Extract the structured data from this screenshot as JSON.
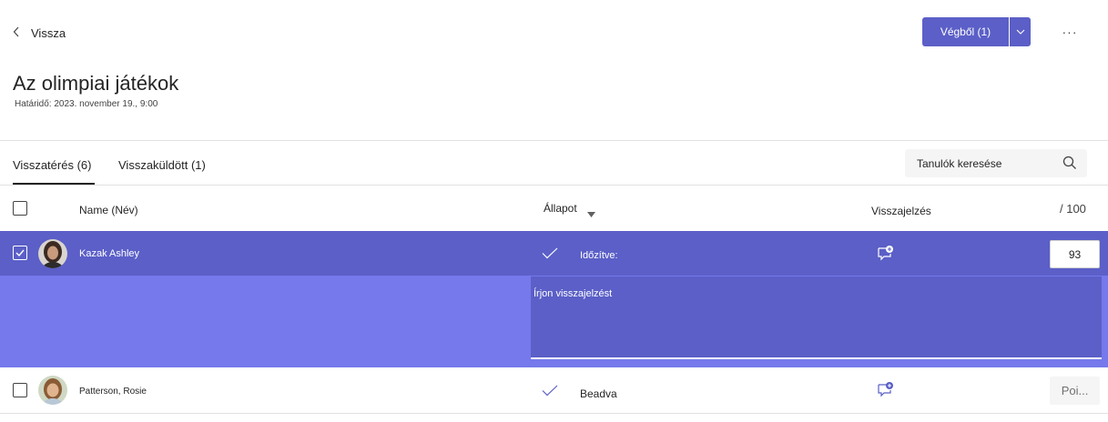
{
  "header": {
    "back_label": "Vissza",
    "primary_button_label": "Végből (1)",
    "more_label": "···"
  },
  "assignment": {
    "title": "Az olimpiai játékok",
    "deadline": "Határidő: 2023. november 19., 9:00"
  },
  "tabs": [
    {
      "label": "Visszatérés (6)",
      "active": true
    },
    {
      "label": "Visszaküldött (1)",
      "active": false
    }
  ],
  "search": {
    "placeholder": "Tanulók keresése"
  },
  "table": {
    "headers": {
      "name": "Name (Név)",
      "status": "Állapot",
      "feedback": "Visszajelzés",
      "points": "/ 100"
    },
    "rows": [
      {
        "name": "Kazak Ashley",
        "status": "Időzítve:",
        "points": "93",
        "selected": true
      },
      {
        "name": "Patterson, Rosie",
        "status": "Beadva",
        "points": "Poi...",
        "selected": false
      }
    ],
    "feedback_placeholder": "Írjon visszajelzést"
  },
  "colors": {
    "accent": "#5b5fc7",
    "expanded_row": "#7579eb",
    "status_check": "#5b5fc7"
  }
}
